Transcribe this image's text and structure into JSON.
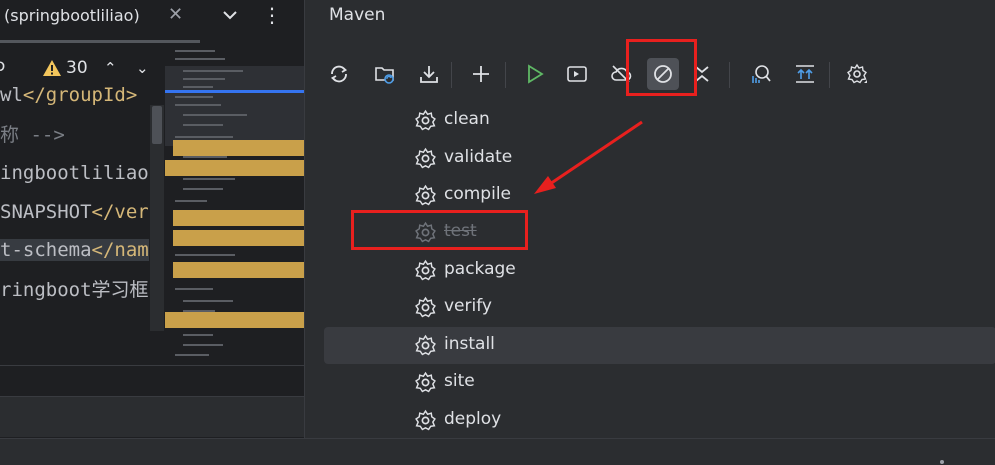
{
  "editor": {
    "tab_title": "(springbootliliao)",
    "tab_close": "✕",
    "tab_more": "⋮",
    "warning_count": "30",
    "warn_up": "⌃",
    "warn_down": "⌄",
    "left_glyph": "ɔ",
    "code_lines": [
      {
        "pre": "wl",
        "tag": "</groupId>"
      },
      {
        "comment": "称 -->"
      },
      {
        "text": "ingbootliliao"
      },
      {
        "text": "SNAPSHOT",
        "tag": "</ver"
      },
      {
        "text": "t-schema",
        "tag": "</nam"
      },
      {
        "text": "ringboot学习框"
      }
    ]
  },
  "maven": {
    "title": "Maven",
    "toolbar": [
      "reload-all-icon",
      "generate-sources-icon",
      "download-icon",
      "add-icon",
      "run-icon",
      "execute-goal-icon",
      "offline-mode-icon",
      "skip-tests-icon",
      "collapse-all-icon",
      "analyze-dependencies-icon",
      "show-dependencies-icon",
      "settings-icon"
    ],
    "lifecycle": [
      {
        "label": "clean",
        "skipped": false,
        "selected": false
      },
      {
        "label": "validate",
        "skipped": false,
        "selected": false
      },
      {
        "label": "compile",
        "skipped": false,
        "selected": false
      },
      {
        "label": "test",
        "skipped": true,
        "selected": false
      },
      {
        "label": "package",
        "skipped": false,
        "selected": false
      },
      {
        "label": "verify",
        "skipped": false,
        "selected": false
      },
      {
        "label": "install",
        "skipped": false,
        "selected": true
      },
      {
        "label": "site",
        "skipped": false,
        "selected": false
      },
      {
        "label": "deploy",
        "skipped": false,
        "selected": false
      }
    ]
  },
  "colors": {
    "accent_red": "#e8201e",
    "run_green": "#5fb865",
    "selection": "#393b40",
    "panel_bg": "#2b2d30",
    "editor_bg": "#1e1f22"
  }
}
